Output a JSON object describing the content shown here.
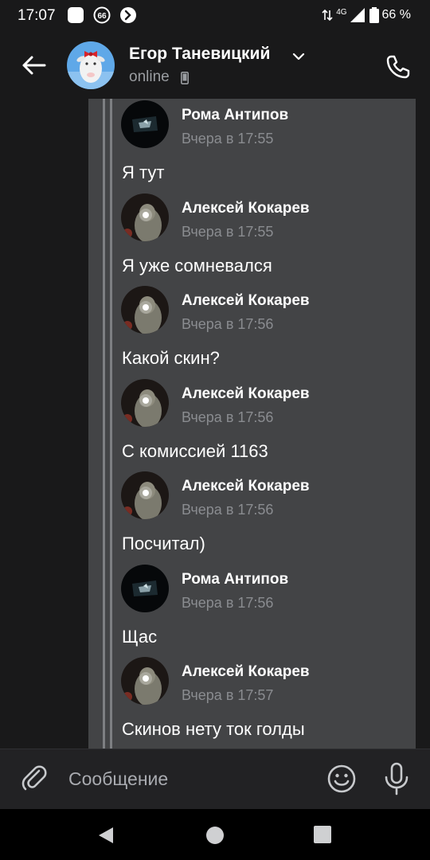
{
  "status_bar": {
    "time": "17:07",
    "notification_badge": "66",
    "network": "4G",
    "battery": "66 %"
  },
  "header": {
    "contact_name": "Егор Таневицкий",
    "contact_status": "online",
    "icons": [
      "back-arrow-icon",
      "chevron-down-icon",
      "mobile-device-icon",
      "phone-icon"
    ]
  },
  "messages": [
    {
      "author": "Рома Антипов",
      "time": "Вчера в 17:55",
      "text": "Я тут",
      "avatar": "roma"
    },
    {
      "author": "Алексей Кокарев",
      "time": "Вчера в 17:55",
      "text": "Я уже сомневался",
      "avatar": "alexey"
    },
    {
      "author": "Алексей Кокарев",
      "time": "Вчера в 17:56",
      "text": "Какой скин?",
      "avatar": "alexey"
    },
    {
      "author": "Алексей Кокарев",
      "time": "Вчера в 17:56",
      "text": "С комиссией 1163",
      "avatar": "alexey"
    },
    {
      "author": "Алексей Кокарев",
      "time": "Вчера в 17:56",
      "text": "Посчитал)",
      "avatar": "alexey"
    },
    {
      "author": "Рома Антипов",
      "time": "Вчера в 17:56",
      "text": "Щас",
      "avatar": "roma"
    },
    {
      "author": "Алексей Кокарев",
      "time": "Вчера в 17:57",
      "text": "Скинов нету ток голды",
      "avatar": "alexey"
    }
  ],
  "composer": {
    "placeholder": "Сообщение",
    "icons": [
      "paperclip-icon",
      "emoji-icon",
      "microphone-icon"
    ]
  },
  "colors": {
    "background": "#19191a",
    "forward_panel": "#434446",
    "forward_bar": "#7d7f82",
    "time_text": "#8a8c90"
  }
}
